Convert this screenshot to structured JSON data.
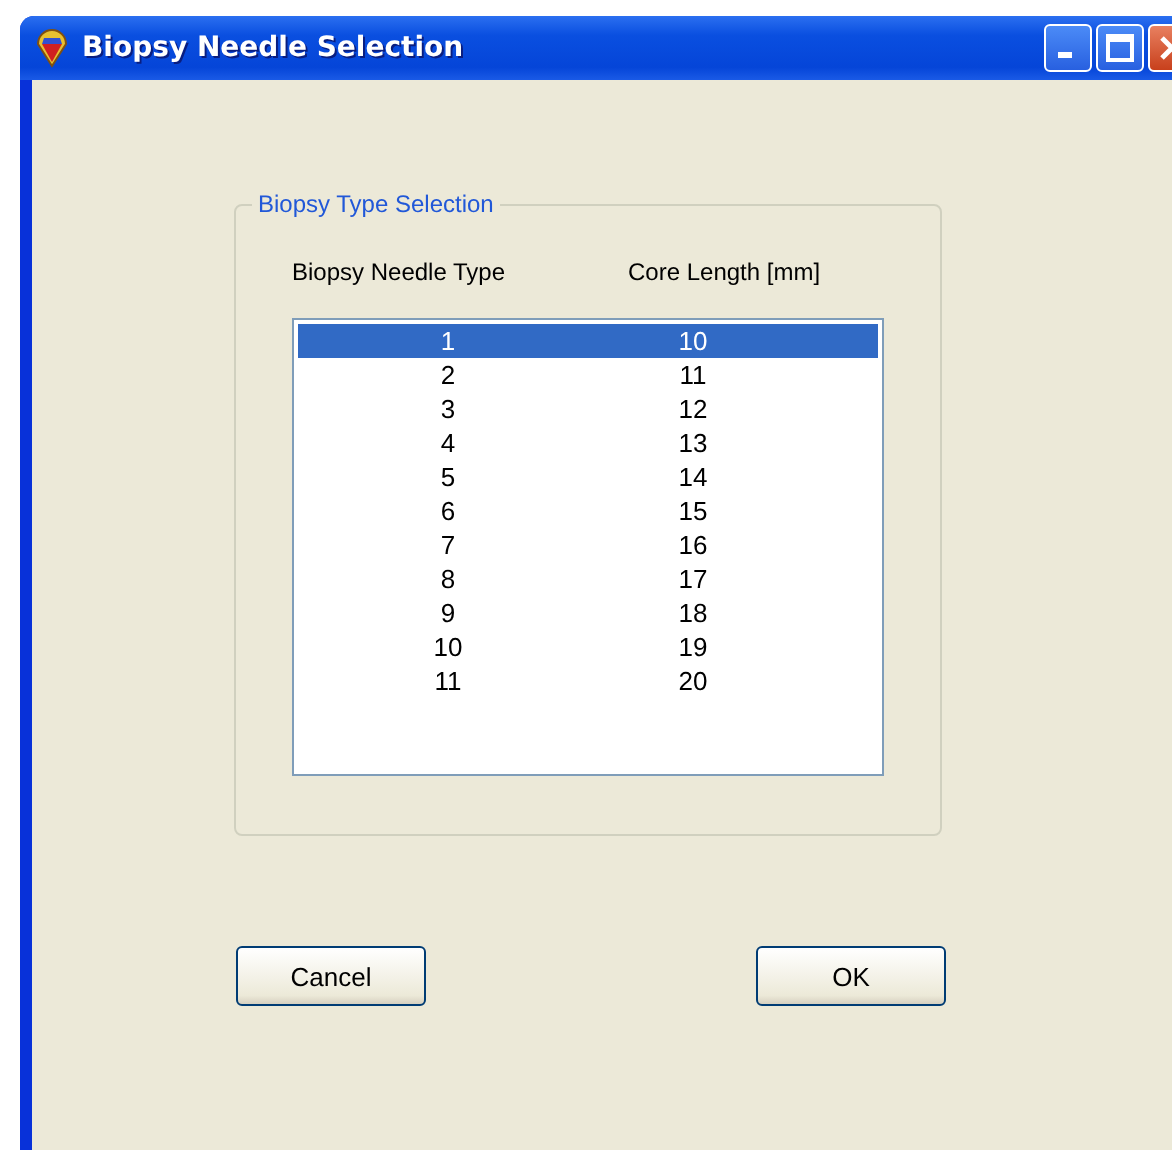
{
  "window": {
    "title": "Biopsy Needle Selection"
  },
  "group": {
    "title": "Biopsy Type Selection",
    "columns": [
      "Biopsy Needle Type",
      "Core Length [mm]"
    ],
    "rows": [
      {
        "type": "1",
        "length": "10",
        "selected": true
      },
      {
        "type": "2",
        "length": "11",
        "selected": false
      },
      {
        "type": "3",
        "length": "12",
        "selected": false
      },
      {
        "type": "4",
        "length": "13",
        "selected": false
      },
      {
        "type": "5",
        "length": "14",
        "selected": false
      },
      {
        "type": "6",
        "length": "15",
        "selected": false
      },
      {
        "type": "7",
        "length": "16",
        "selected": false
      },
      {
        "type": "8",
        "length": "17",
        "selected": false
      },
      {
        "type": "9",
        "length": "18",
        "selected": false
      },
      {
        "type": "10",
        "length": "19",
        "selected": false
      },
      {
        "type": "11",
        "length": "20",
        "selected": false
      }
    ]
  },
  "buttons": [
    "Cancel",
    "OK"
  ]
}
